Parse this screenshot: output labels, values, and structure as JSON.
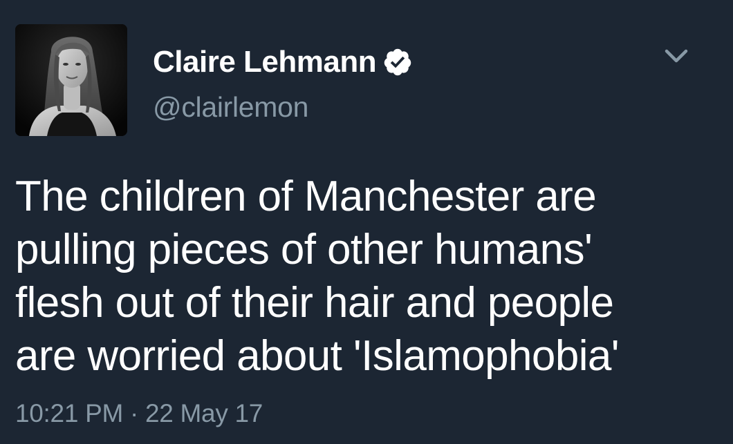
{
  "tweet": {
    "author": {
      "display_name": "Claire Lehmann",
      "handle": "@clairlemon",
      "verified": true,
      "avatar_icon": "profile-photo"
    },
    "text": "The children of Manchester are\npulling pieces of other humans'\nflesh out of their hair and people\nare worried about 'Islamophobia'",
    "time": "10:21 PM",
    "separator": "·",
    "date": "22 May 17",
    "menu_icon": "chevron-down-icon"
  },
  "colors": {
    "background": "#1c2633",
    "primary_text": "#ffffff",
    "secondary_text": "#8899a6",
    "verified_badge": "#ffffff"
  }
}
